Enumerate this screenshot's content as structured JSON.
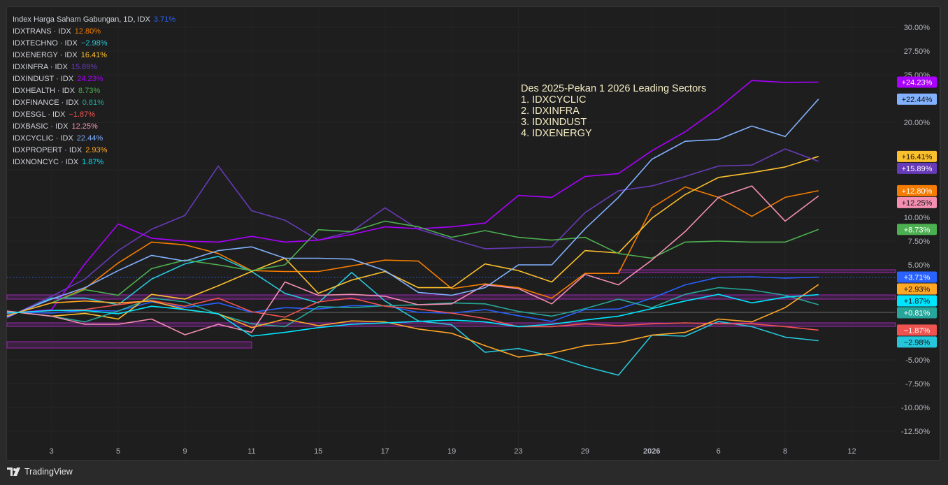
{
  "chart_data": {
    "type": "line",
    "title": "Index Harga Saham Gabungan, 1D, IDX",
    "ylabel": "% change",
    "ylim": [
      -13.5,
      31
    ],
    "y_ticks": [
      "30.00%",
      "27.50%",
      "25.00%",
      "20.00%",
      "15.00%",
      "10.00%",
      "7.50%",
      "5.00%",
      "-5.00%",
      "-7.50%",
      "-10.00%",
      "-12.50%"
    ],
    "y_tick_values": [
      30,
      27.5,
      25,
      20,
      15,
      10,
      7.5,
      5,
      -5,
      -7.5,
      -10,
      -12.5
    ],
    "x_ticks": [
      {
        "label": "3",
        "index": 1
      },
      {
        "label": "5",
        "index": 3
      },
      {
        "label": "9",
        "index": 5
      },
      {
        "label": "11",
        "index": 7
      },
      {
        "label": "15",
        "index": 9
      },
      {
        "label": "17",
        "index": 11
      },
      {
        "label": "19",
        "index": 13
      },
      {
        "label": "23",
        "index": 15
      },
      {
        "label": "29",
        "index": 17
      },
      {
        "label": "2026",
        "index": 19,
        "bold": true
      },
      {
        "label": "6",
        "index": 21
      },
      {
        "label": "8",
        "index": 23
      },
      {
        "label": "12",
        "index": 25
      }
    ],
    "series": [
      {
        "name": "Index Harga Saham Gabungan, 1D, IDX",
        "legend": "Index Harga Saham Gabungan, 1D, IDX",
        "last": "3.71%",
        "tag": "+3.71%",
        "color": "#2962ff",
        "tagText": "#ffffff",
        "values": [
          0,
          -0.07,
          0.2,
          0.15,
          1.1,
          0.5,
          1.0,
          0,
          0.5,
          0.35,
          0.7,
          0.7,
          0,
          -0.07,
          0.3,
          -0.35,
          -0.95,
          0.3,
          0.35,
          1.5,
          2.9,
          3.7,
          3.75,
          3.6,
          3.71
        ]
      },
      {
        "name": "IDXTRANS",
        "legend": "IDXTRANS · IDX",
        "last": "12.80%",
        "tag": "+12.80%",
        "color": "#f57c00",
        "tagText": "#ffffff",
        "values": [
          0,
          1.0,
          2.5,
          5.2,
          7.4,
          7.1,
          6.2,
          4.4,
          4.3,
          4.3,
          4.9,
          5.5,
          5.4,
          2.5,
          3.0,
          2.6,
          1.5,
          4.1,
          4.1,
          11.0,
          13.2,
          12.1,
          10.1,
          12.1,
          12.8
        ]
      },
      {
        "name": "IDXTECHNO",
        "legend": "IDXTECHNO · IDX",
        "last": "−2.98%",
        "tag": "−2.98%",
        "color": "#26c6da",
        "tagText": "#111111",
        "values": [
          0,
          1.5,
          1.5,
          0.8,
          3.5,
          5.1,
          5.9,
          4.3,
          2.0,
          1.0,
          4.2,
          1.2,
          -0.9,
          -1.3,
          -4.2,
          -3.8,
          -4.6,
          -5.7,
          -6.6,
          -2.4,
          -2.5,
          -0.95,
          -1.5,
          -2.6,
          -2.98
        ]
      },
      {
        "name": "IDXENERGY",
        "legend": "IDXENERGY · IDX",
        "last": "16.41%",
        "tag": "+16.41%",
        "color": "#fbc02d",
        "tagText": "#111111",
        "values": [
          0,
          -0.4,
          -0.1,
          -0.7,
          1.9,
          1.4,
          2.8,
          4.3,
          5.7,
          2.0,
          3.4,
          4.3,
          2.6,
          2.6,
          5.1,
          4.4,
          3.2,
          6.5,
          6.25,
          9.9,
          12.4,
          14.2,
          14.7,
          15.3,
          16.41
        ]
      },
      {
        "name": "IDXINFRA",
        "legend": "IDXINFRA · IDX",
        "last": "15.89%",
        "tag": "+15.89%",
        "color": "#673ab7",
        "tagText": "#ffffff",
        "values": [
          0,
          1.7,
          3.5,
          6.5,
          8.75,
          10.2,
          15.4,
          10.7,
          9.7,
          7.6,
          8.5,
          11.0,
          8.75,
          7.7,
          6.7,
          6.8,
          6.9,
          10.5,
          12.8,
          13.3,
          14.3,
          15.4,
          15.5,
          17.2,
          15.89
        ]
      },
      {
        "name": "IDXINDUST",
        "legend": "IDXINDUST · IDX",
        "last": "24.23%",
        "tag": "+24.23%",
        "color": "#aa00ff",
        "tagText": "#ffffff",
        "values": [
          0,
          0.29,
          5.1,
          9.3,
          7.8,
          7.5,
          7.4,
          8.0,
          7.4,
          7.6,
          8.2,
          9.0,
          8.8,
          9.0,
          9.4,
          12.3,
          12.1,
          14.3,
          14.6,
          17.0,
          19.0,
          21.5,
          24.4,
          24.2,
          24.23
        ]
      },
      {
        "name": "IDXHEALTH",
        "legend": "IDXHEALTH · IDX",
        "last": "8.73%",
        "tag": "+8.73%",
        "color": "#4caf50",
        "tagText": "#ffffff",
        "values": [
          0,
          1.0,
          2.4,
          1.8,
          4.6,
          5.5,
          5.0,
          4.4,
          5.0,
          8.7,
          8.5,
          9.6,
          9.0,
          7.9,
          8.6,
          7.9,
          7.6,
          7.9,
          6.2,
          5.7,
          7.4,
          7.5,
          7.4,
          7.4,
          8.73
        ]
      },
      {
        "name": "IDXFINANCE",
        "legend": "IDXFINANCE · IDX",
        "last": "0.81%",
        "tag": "+0.81%",
        "color": "#26a69a",
        "tagText": "#ffffff",
        "values": [
          0,
          -0.4,
          -1.0,
          0.15,
          1.5,
          1.1,
          -0.2,
          -1.2,
          -1.5,
          0.6,
          0.5,
          0.7,
          0.8,
          1.0,
          0.9,
          0.1,
          -0.4,
          0.4,
          1.4,
          0.5,
          1.9,
          2.6,
          2.35,
          1.8,
          0.81
        ]
      },
      {
        "name": "IDXESGL",
        "legend": "IDXESGL · IDX",
        "last": "−1.87%",
        "tag": "−1.87%",
        "color": "#ef5350",
        "tagText": "#ffffff",
        "values": [
          0,
          0.2,
          0.3,
          0.8,
          1.25,
          0.65,
          1.5,
          0.07,
          -0.5,
          1.1,
          1.5,
          0.65,
          0.35,
          -0.07,
          -0.65,
          -1.5,
          -1.5,
          -1.2,
          -1.4,
          -1.2,
          -1.1,
          -1.2,
          -1.2,
          -1.5,
          -1.87
        ]
      },
      {
        "name": "IDXBASIC",
        "legend": "IDXBASIC · IDX",
        "last": "12.25%",
        "tag": "+12.25%",
        "color": "#f48fb1",
        "tagText": "#111111",
        "values": [
          0,
          -0.4,
          -1.25,
          -1.25,
          -0.7,
          -2.35,
          -1.25,
          -2.1,
          3.2,
          1.8,
          1.9,
          1.7,
          0.8,
          0.9,
          2.9,
          2.5,
          0.9,
          4.0,
          2.9,
          5.5,
          8.5,
          12.1,
          13.3,
          9.6,
          12.25
        ]
      },
      {
        "name": "IDXCYCLIC",
        "legend": "IDXCYCLIC · IDX",
        "last": "22.44%",
        "tag": "+22.44%",
        "color": "#82b1ff",
        "tagText": "#111111",
        "values": [
          0,
          1.4,
          2.6,
          4.4,
          6.0,
          5.4,
          6.5,
          6.9,
          5.7,
          5.7,
          5.6,
          4.4,
          2.1,
          1.8,
          2.6,
          5.0,
          5.0,
          8.8,
          12.1,
          16.1,
          18.0,
          18.2,
          19.6,
          18.5,
          22.44
        ]
      },
      {
        "name": "IDXPROPERT",
        "legend": "IDXPROPERT · IDX",
        "last": "2.93%",
        "tag": "+2.93%",
        "color": "#ffa726",
        "tagText": "#111111",
        "values": [
          0,
          1.0,
          1.2,
          1.0,
          1.2,
          0.3,
          -0.15,
          -1.6,
          -0.7,
          -1.4,
          -0.9,
          -1.0,
          -1.75,
          -2.2,
          -3.5,
          -4.7,
          -4.3,
          -3.5,
          -3.2,
          -2.4,
          -2.1,
          -0.7,
          -1.0,
          0.5,
          2.93
        ]
      },
      {
        "name": "IDXNONCYC",
        "legend": "IDXNONCYC · IDX",
        "last": "1.87%",
        "tag": "+1.87%",
        "color": "#00e5ff",
        "tagText": "#111111",
        "values": [
          0,
          0.2,
          0.2,
          -0.15,
          0.65,
          0.3,
          -0.15,
          -2.5,
          -2.1,
          -1.6,
          -1.25,
          -1.1,
          -0.95,
          -0.8,
          -1.0,
          -1.5,
          -1.25,
          -0.8,
          -0.4,
          0.4,
          1.2,
          1.9,
          1.0,
          1.6,
          1.87
        ]
      }
    ],
    "annotation": {
      "title": "Des 2025-Pekan 1 2026 Leading Sectors",
      "items": [
        "1. IDXCYCLIC",
        "2. IDXINFRA",
        "3. IDXINDUST",
        "4. IDXENERGY"
      ]
    }
  },
  "footer": {
    "brand": "TradingView"
  }
}
